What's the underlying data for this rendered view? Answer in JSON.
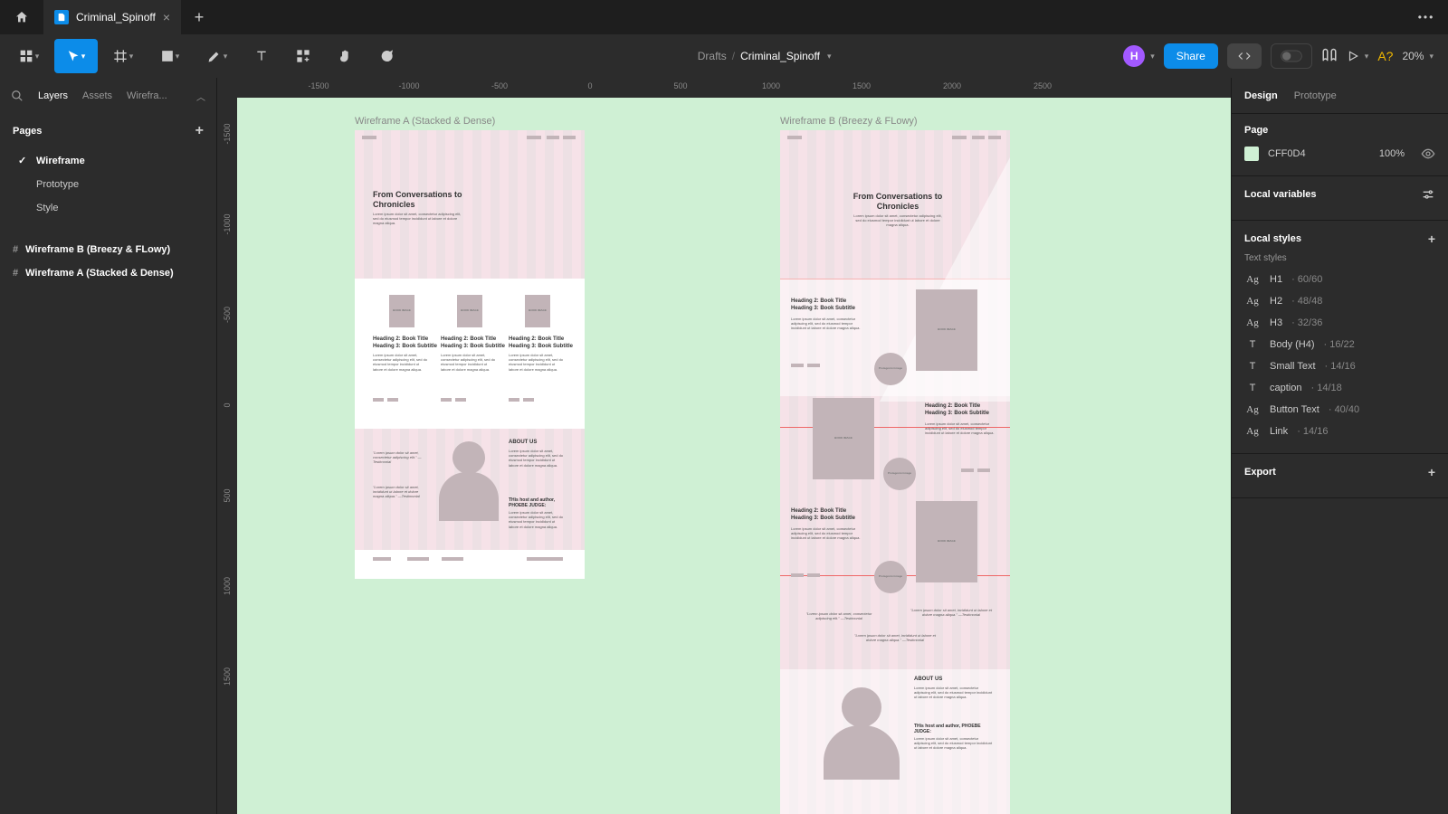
{
  "tab": {
    "title": "Criminal_Spinoff"
  },
  "breadcrumb": {
    "drafts": "Drafts",
    "file": "Criminal_Spinoff"
  },
  "toolbar": {
    "share": "Share",
    "zoom": "20%",
    "a_mark": "A?",
    "avatar_initial": "H"
  },
  "left": {
    "tabs": {
      "layers": "Layers",
      "assets": "Assets",
      "wireframe": "Wirefra..."
    },
    "pages_label": "Pages",
    "pages": [
      {
        "name": "Wireframe",
        "active": true
      },
      {
        "name": "Prototype",
        "active": false
      },
      {
        "name": "Style",
        "active": false
      }
    ],
    "layers": [
      {
        "name": "Wireframe B (Breezy & FLowy)"
      },
      {
        "name": "Wireframe A (Stacked & Dense)"
      }
    ]
  },
  "canvas": {
    "ruler_h": [
      "-1500",
      "-1000",
      "-500",
      "0",
      "500",
      "1000",
      "1500",
      "2000",
      "2500"
    ],
    "ruler_v": [
      "-1500",
      "-1000",
      "-500",
      "0",
      "500",
      "1000",
      "1500"
    ],
    "frameA_label": "Wireframe A (Stacked & Dense)",
    "frameB_label": "Wireframe B (Breezy & FLowy)",
    "hero_title": "From Conversations to Chronicles",
    "hero_body": "Lorem ipsum dolor sit amet, consectetur adipiscing elit, sed do eiusmod tempor incididunt ut labore et dolore magna aliqua.",
    "book_image": "BOOK IMAGE",
    "protag": "Protagonist image",
    "h2": "Heading 2: Book Title",
    "h3": "Heading 3: Book Subtitle",
    "about": "ABOUT US",
    "host": "THis host and author, PHOEBE JUDGE:",
    "quote1": "\"Lorem ipsum dolor sit amet, consectetur adipiscing elit.\" —Testimonial",
    "quote2": "\"Lorem ipsum dolor sit amet, incididunt ut labore et dolore magna aliqua.\" —Testimonial"
  },
  "right": {
    "tabs": {
      "design": "Design",
      "prototype": "Prototype"
    },
    "page_label": "Page",
    "page_color": "CFF0D4",
    "page_opacity": "100%",
    "local_vars": "Local variables",
    "local_styles": "Local styles",
    "text_styles_label": "Text styles",
    "text_styles": [
      {
        "glyph": "Ag",
        "serif": true,
        "name": "H1",
        "meta": "60/60"
      },
      {
        "glyph": "Ag",
        "serif": true,
        "name": "H2",
        "meta": "48/48"
      },
      {
        "glyph": "Ag",
        "serif": true,
        "name": "H3",
        "meta": "32/36"
      },
      {
        "glyph": "T",
        "serif": false,
        "name": "Body (H4)",
        "meta": "16/22"
      },
      {
        "glyph": "T",
        "serif": false,
        "name": "Small Text",
        "meta": "14/16"
      },
      {
        "glyph": "T",
        "serif": false,
        "name": "caption",
        "meta": "14/18"
      },
      {
        "glyph": "Ag",
        "serif": true,
        "name": "Button Text",
        "meta": "40/40"
      },
      {
        "glyph": "Ag",
        "serif": true,
        "name": "Link",
        "meta": "14/16"
      }
    ],
    "export": "Export"
  }
}
